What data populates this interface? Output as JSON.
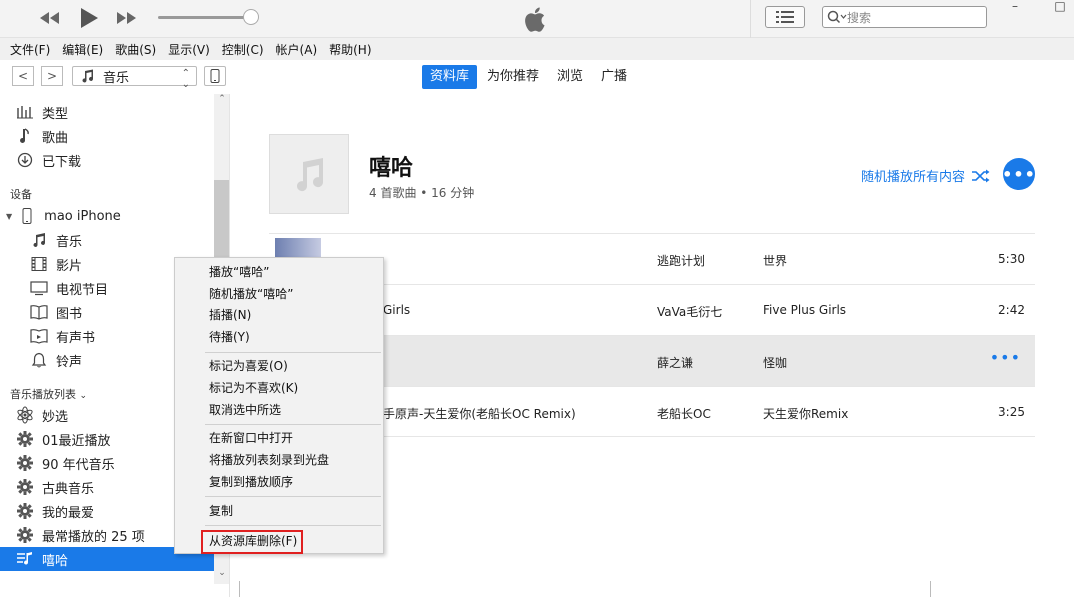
{
  "toolbar": {
    "prev_icon": "rewind-icon",
    "play_icon": "play-icon",
    "next_icon": "fast-forward-icon",
    "volume_level": 0.9,
    "search_placeholder": "搜索",
    "min_label": "–",
    "max_label": "□"
  },
  "menubar": [
    "文件(F)",
    "编辑(E)",
    "歌曲(S)",
    "显示(V)",
    "控制(C)",
    "帐户(A)",
    "帮助(H)"
  ],
  "nav": {
    "back": "<",
    "forward": ">",
    "source": "音乐",
    "tabs": [
      {
        "label": "资料库",
        "active": true
      },
      {
        "label": "为你推荐",
        "active": false
      },
      {
        "label": "浏览",
        "active": false
      },
      {
        "label": "广播",
        "active": false
      }
    ]
  },
  "sidebar": {
    "library_items": [
      {
        "label": "类型",
        "icon": "genre-icon"
      },
      {
        "label": "歌曲",
        "icon": "note-icon"
      },
      {
        "label": "已下载",
        "icon": "download-icon"
      }
    ],
    "devices_header": "设备",
    "device_name": "mao iPhone",
    "device_items": [
      {
        "label": "音乐",
        "icon": "music-icon"
      },
      {
        "label": "影片",
        "icon": "film-icon"
      },
      {
        "label": "电视节目",
        "icon": "tv-icon"
      },
      {
        "label": "图书",
        "icon": "book-icon"
      },
      {
        "label": "有声书",
        "icon": "audiobook-icon"
      },
      {
        "label": "铃声",
        "icon": "bell-icon"
      }
    ],
    "playlists_header": "音乐播放列表",
    "playlist_items": [
      {
        "label": "妙选",
        "icon": "genius-icon"
      },
      {
        "label": "01最近播放",
        "icon": "gear-icon"
      },
      {
        "label": "90 年代音乐",
        "icon": "gear-icon"
      },
      {
        "label": "古典音乐",
        "icon": "gear-icon"
      },
      {
        "label": "我的最爱",
        "icon": "gear-icon"
      },
      {
        "label": "最常播放的 25 项",
        "icon": "gear-icon"
      },
      {
        "label": "嘻哈",
        "icon": "playlist-icon",
        "selected": true
      }
    ]
  },
  "playlist": {
    "title": "嘻哈",
    "subtitle": "4 首歌曲 • 16 分钟",
    "shuffle_label": "随机播放所有内容",
    "more_label": "•••"
  },
  "tracks": [
    {
      "name": "",
      "artist": "逃跑计划",
      "album": "世界",
      "time": "5:30",
      "thumb": true
    },
    {
      "name": "Girls",
      "artist": "VaVa毛衍七",
      "album": "Five Plus Girls",
      "time": "2:42"
    },
    {
      "name": "",
      "artist": "薛之谦",
      "album": "怪咖",
      "time": "",
      "highlighted": true,
      "more": "•••"
    },
    {
      "name": "手原声-天生爱你(老船长OC Remix)",
      "artist": "老船长OC",
      "album": "天生爱你Remix",
      "time": "3:25"
    }
  ],
  "context_menu": {
    "groups": [
      [
        "播放“嘻哈”",
        "随机播放“嘻哈”",
        "插播(N)",
        "待播(Y)"
      ],
      [
        "标记为喜爱(O)",
        "标记为不喜欢(K)",
        "取消选中所选"
      ],
      [
        "在新窗口中打开",
        "将播放列表刻录到光盘",
        "复制到播放顺序"
      ],
      [
        "复制"
      ],
      [
        "从资源库删除(F)"
      ]
    ]
  }
}
